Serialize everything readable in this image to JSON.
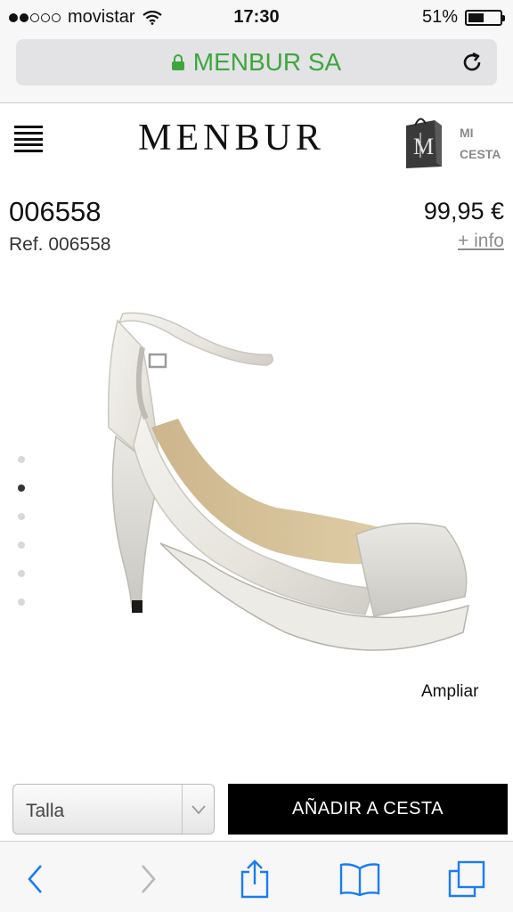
{
  "status_bar": {
    "carrier": "movistar",
    "signal_bars": 2,
    "signal_total": 5,
    "time": "17:30",
    "battery_percent": "51%",
    "battery_level": 0.51
  },
  "browser": {
    "address": "MENBUR SA",
    "secure": true,
    "accent_color": "#3ea63e"
  },
  "header": {
    "logo": "MENBUR",
    "cart_label_line1": "MI",
    "cart_label_line2": "CESTA"
  },
  "product": {
    "name": "006558",
    "ref": "Ref. 006558",
    "price": "99,95 €",
    "more_info": "+ info",
    "zoom_label": "Ampliar",
    "image_count": 6,
    "active_image": 2
  },
  "actions": {
    "size_placeholder": "Talla",
    "add_to_cart": "AÑADIR A CESTA"
  },
  "icons": {
    "menu": "hamburger-menu-icon",
    "cart": "shopping-bag-icon",
    "reload": "reload-icon",
    "lock": "lock-icon",
    "back": "chevron-left-icon",
    "forward": "chevron-right-icon",
    "share": "share-icon",
    "bookmarks": "book-icon",
    "tabs": "tabs-icon"
  }
}
